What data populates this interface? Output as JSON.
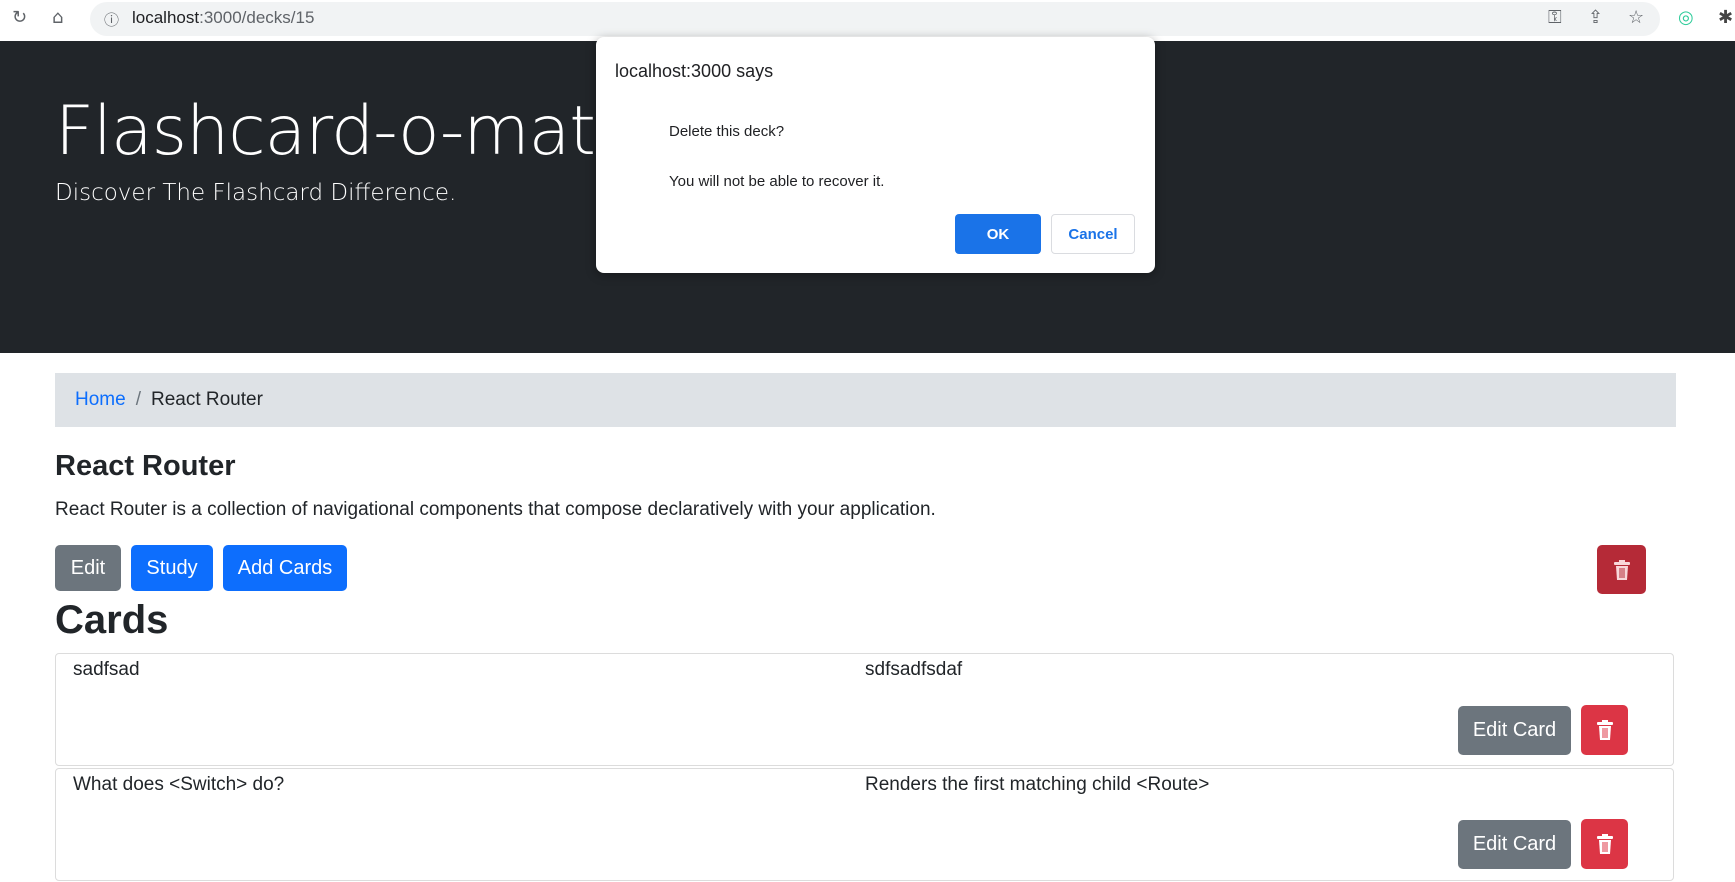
{
  "browser": {
    "url_host": "localhost",
    "url_path": ":3000/decks/15"
  },
  "hero": {
    "title": "Flashcard-o-matic",
    "subtitle": "Discover The Flashcard Difference."
  },
  "breadcrumb": {
    "home": "Home",
    "separator": "/",
    "current": "React Router"
  },
  "deck": {
    "name": "React Router",
    "description": "React Router is a collection of navigational components that compose declaratively with your application.",
    "edit_label": "Edit",
    "study_label": "Study",
    "add_cards_label": "Add Cards"
  },
  "cards_heading": "Cards",
  "cards": [
    {
      "front": "sadfsad",
      "back": "sdfsadfsdaf",
      "edit_label": "Edit Card"
    },
    {
      "front": "What does <Switch> do?",
      "back": "Renders the first matching child <Route>",
      "edit_label": "Edit Card"
    }
  ],
  "dialog": {
    "title": "localhost:3000 says",
    "message_line1": "Delete this deck?",
    "message_line2": "You will not be able to recover it.",
    "ok_label": "OK",
    "cancel_label": "Cancel"
  },
  "colors": {
    "hero_bg": "#212529",
    "primary": "#0d6efd",
    "secondary": "#6c757d",
    "danger": "#dc3545"
  }
}
